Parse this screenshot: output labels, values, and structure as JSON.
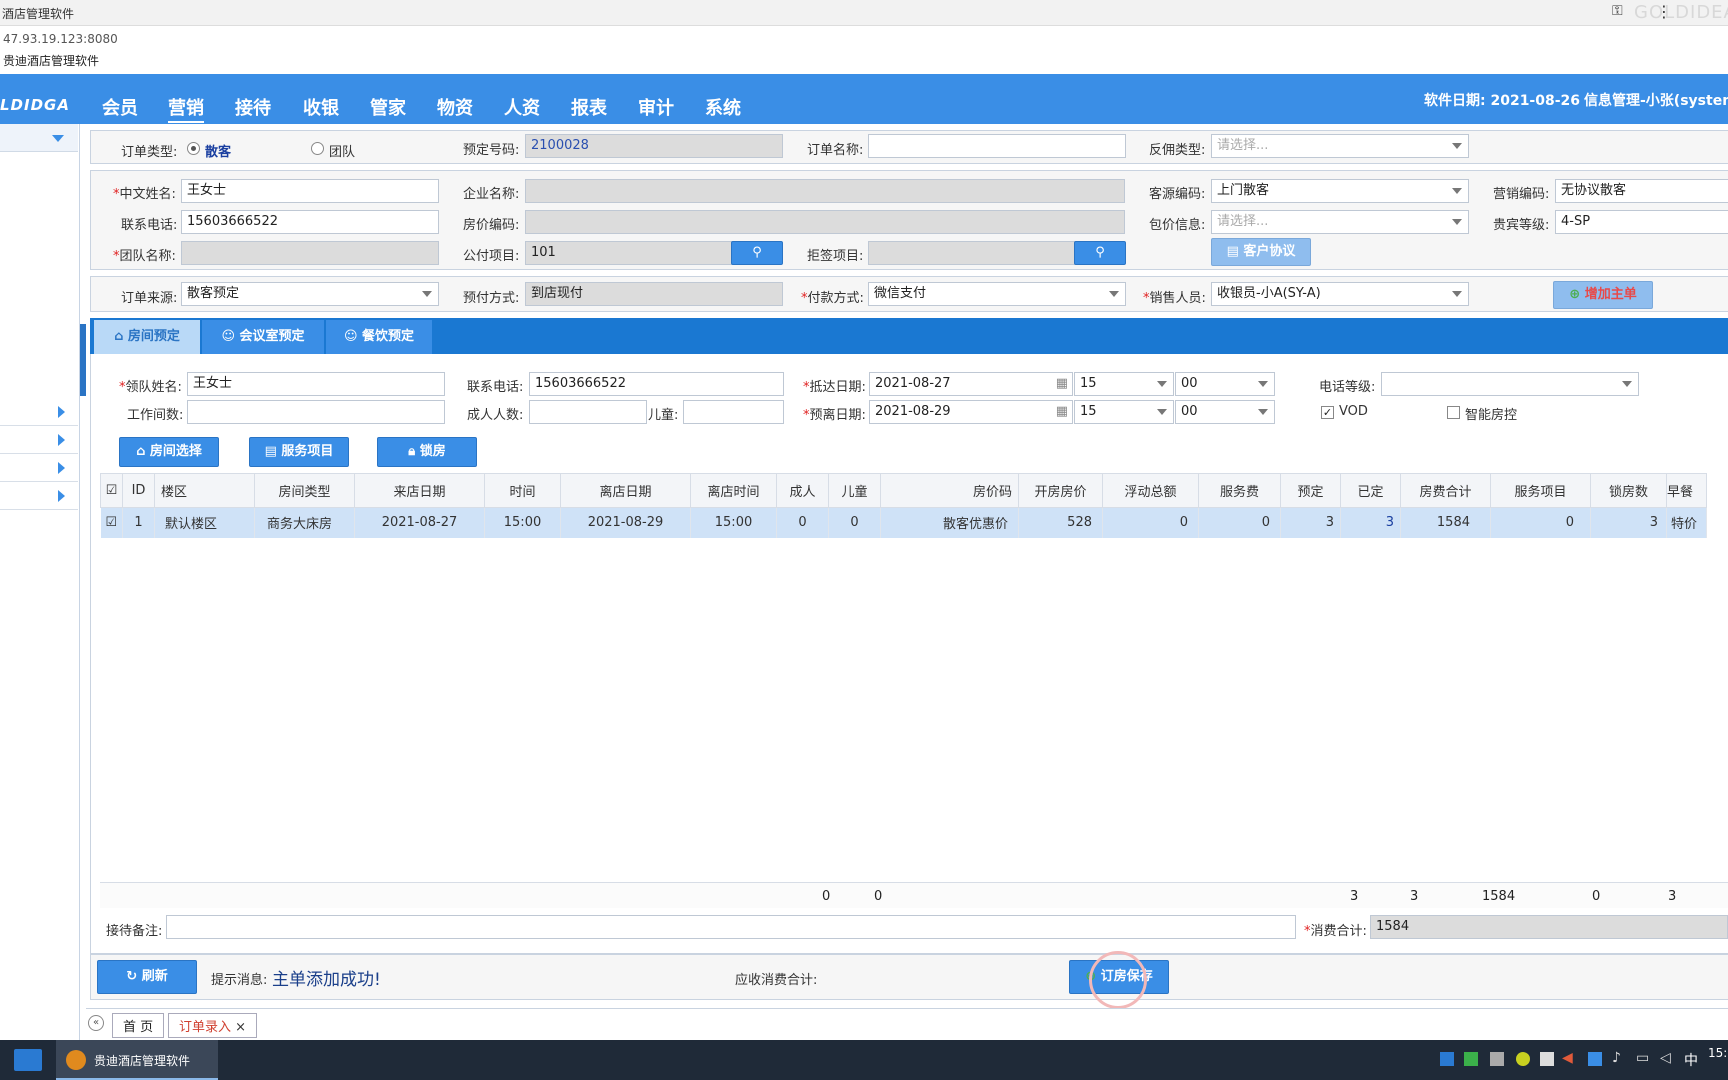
{
  "window": {
    "title": "酒店管理软件"
  },
  "address": {
    "url": "47.93.19.123:8080",
    "page_title": "贵迪酒店管理软件"
  },
  "brand": {
    "logo_text": "LDIDGA",
    "watermark": "GOLDIDEA"
  },
  "nav": {
    "items": [
      "会员",
      "营销",
      "接待",
      "收银",
      "管家",
      "物资",
      "人资",
      "报表",
      "审计",
      "系统"
    ],
    "active": "营销"
  },
  "status": {
    "software_date": "软件日期: 2021-08-26",
    "user": "信息管理-小张(system)"
  },
  "order": {
    "type_label": "订单类型:",
    "type_options": [
      "散客",
      "团队"
    ],
    "type_selected": "散客",
    "booking_no_label": "预定号码:",
    "booking_no": "2100028",
    "order_name_label": "订单名称:",
    "order_name": "",
    "commission_label": "反佣类型:",
    "commission_placeholder": "请选择..."
  },
  "guest": {
    "cn_name_label": "中文姓名:",
    "cn_name": "王女士",
    "company_label": "企业名称:",
    "company": "",
    "source_label": "客源编码:",
    "source": "上门散客",
    "marketing_label": "营销编码:",
    "marketing": "无协议散客",
    "phone_label": "联系电话:",
    "phone": "15603666522",
    "rate_code_label": "房价编码:",
    "rate_code": "",
    "package_label": "包价信息:",
    "package_placeholder": "请选择...",
    "vip_label": "贵宾等级:",
    "vip": "4-SP",
    "group_label": "团队名称:",
    "group": "",
    "public_label": "公付项目:",
    "public": "101",
    "refuse_label": "拒签项目:",
    "refuse": "",
    "agreement_button": "客户协议"
  },
  "payment": {
    "source_label": "订单来源:",
    "source": "散客预定",
    "prepay_label": "预付方式:",
    "prepay": "到店现付",
    "pay_label": "付款方式:",
    "pay": "微信支付",
    "sales_label": "销售人员:",
    "sales": "收银员-小A(SY-A)",
    "add_button": "增加主单"
  },
  "tabs": [
    "房间预定",
    "会议室预定",
    "餐饮预定"
  ],
  "room": {
    "leader_label": "领队姓名:",
    "leader": "王女士",
    "phone_label": "联系电话:",
    "phone": "15603666522",
    "arrive_label": "抵达日期:",
    "arrive_date": "2021-08-27",
    "arrive_hour": "15",
    "arrive_min": "00",
    "phone_level_label": "电话等级:",
    "phone_level": "",
    "workroom_label": "工作间数:",
    "workroom": "",
    "adults_label": "成人人数:",
    "adults": "",
    "children_label": "儿童:",
    "children": "",
    "depart_label": "预离日期:",
    "depart_date": "2021-08-29",
    "depart_hour": "15",
    "depart_min": "00",
    "vod_label": "VOD",
    "vod_checked": true,
    "smart_label": "智能房控",
    "smart_checked": false
  },
  "actions": {
    "select_room": "房间选择",
    "service": "服务项目",
    "lock": "锁房"
  },
  "grid": {
    "headers": [
      "ID",
      "楼区",
      "房间类型",
      "来店日期",
      "时间",
      "离店日期",
      "离店时间",
      "成人",
      "儿童",
      "房价码",
      "开房房价",
      "浮动总额",
      "服务费",
      "预定",
      "已定",
      "房费合计",
      "服务项目",
      "锁房数",
      "早餐"
    ],
    "rows": [
      [
        "1",
        "默认楼区",
        "商务大床房",
        "2021-08-27",
        "15:00",
        "2021-08-29",
        "15:00",
        "0",
        "0",
        "散客优惠价",
        "528",
        "0",
        "0",
        "3",
        "3",
        "1584",
        "0",
        "3",
        "特价"
      ]
    ],
    "totals": {
      "adults": "0",
      "children": "0",
      "booked": "3",
      "confirmed": "3",
      "room_total": "1584",
      "service": "0",
      "locked": "3"
    }
  },
  "footer": {
    "remark_label": "接待备注:",
    "remark": "",
    "consume_label": "消费合计:",
    "consume": "1584",
    "refresh": "刷新",
    "tip_label": "提示消息:",
    "tip": "主单添加成功!",
    "receivable_label": "应收消费合计:",
    "save": "订房保存"
  },
  "pagetabs": [
    "首 页",
    "订单录入"
  ],
  "taskbar": {
    "app": "贵迪酒店管理软件",
    "ime": "中",
    "time": "15:"
  }
}
